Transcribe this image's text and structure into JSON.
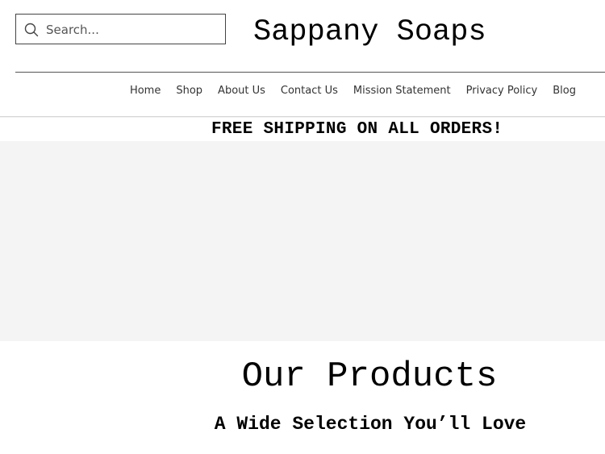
{
  "search": {
    "placeholder": "Search..."
  },
  "site": {
    "title": "Sappany Soaps"
  },
  "nav": {
    "items": [
      {
        "label": "Home"
      },
      {
        "label": "Shop"
      },
      {
        "label": "About Us"
      },
      {
        "label": "Contact Us"
      },
      {
        "label": "Mission Statement"
      },
      {
        "label": "Privacy Policy"
      },
      {
        "label": "Blog"
      }
    ]
  },
  "banner": {
    "text": "FREE SHIPPING ON ALL ORDERS!"
  },
  "products": {
    "title": "Our Products",
    "subtitle": "A Wide Selection You’ll Love"
  },
  "colors": {
    "hero_background": "#f4f4f4",
    "text": "#000000",
    "nav_text": "#333333"
  },
  "icons": {
    "search": "search-icon"
  }
}
